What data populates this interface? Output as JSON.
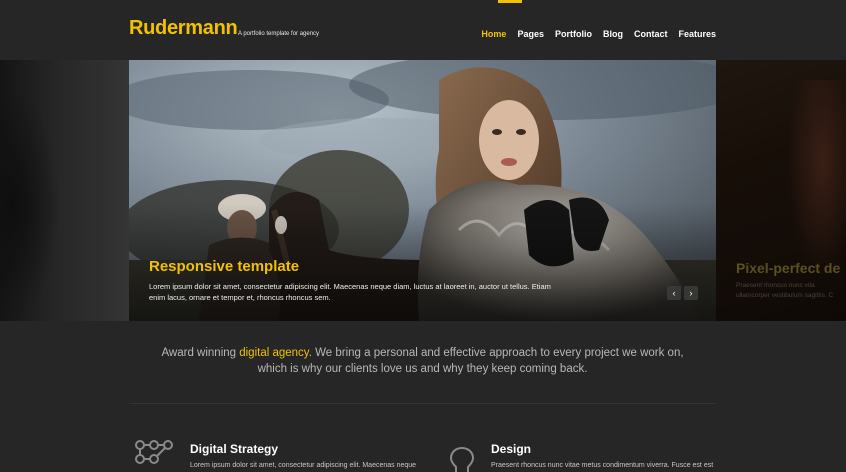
{
  "header": {
    "logo": "Rudermann",
    "tagline": "A portfolio template for agency",
    "nav": [
      "Home",
      "Pages",
      "Portfolio",
      "Blog",
      "Contact",
      "Features"
    ],
    "active_nav": "Home"
  },
  "slider": {
    "caption_title": "Responsive template",
    "caption_text": "Lorem ipsum dolor sit amet, consectetur adipiscing elit. Maecenas neque diam, luctus at laoreet in, auctor ut tellus. Etiam enim lacus, ornare et tempor et, rhoncus rhoncus sem.",
    "prev_arrow": "‹",
    "next_arrow": "›",
    "next_slide_title": "Pixel-perfect de",
    "next_slide_line1": "Praesent rhoncus nunc vita",
    "next_slide_line2": "ullamcorper vestibulum sagittis. C"
  },
  "intro": {
    "before": "Award winning ",
    "highlight": "digital agency",
    "after": ". We bring a personal and effective approach to every project we work on,",
    "line2": "which is why our clients love us and why they keep coming back."
  },
  "services": [
    {
      "title": "Digital Strategy",
      "text": "Lorem ipsum dolor sit amet, consectetur adipiscing elit. Maecenas neque",
      "icon": "network-nodes-icon"
    },
    {
      "title": "Design",
      "text": "Praesent rhoncus nunc vitae metus condimentum viverra. Fusce est est",
      "icon": "lightbulb-icon"
    }
  ],
  "colors": {
    "accent": "#f2c200",
    "background": "#262626"
  }
}
